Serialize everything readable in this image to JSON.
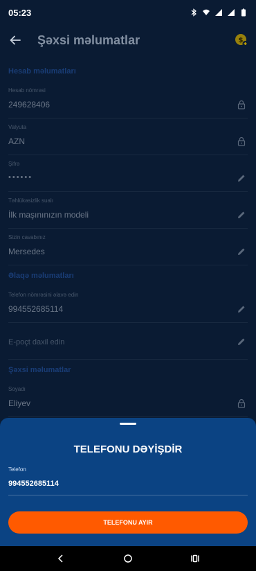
{
  "status_bar": {
    "time": "05:23"
  },
  "app_bar": {
    "title": "Şəxsi məlumatlar"
  },
  "sections": {
    "account": {
      "title": "Hesab məlumatları",
      "fields": [
        {
          "label": "Hesab nömrəsi",
          "value": "249628406",
          "icon": "lock-icon"
        },
        {
          "label": "Valyuta",
          "value": "AZN",
          "icon": "lock-icon"
        },
        {
          "label": "Şifrə",
          "value": "••••••",
          "icon": "pencil-icon"
        },
        {
          "label": "Təhlükəsizlik sualı",
          "value": "İlk maşınınızın modeli",
          "icon": "pencil-icon"
        },
        {
          "label": "Sizin cavabınız",
          "value": "Mersedes",
          "icon": "pencil-icon"
        }
      ]
    },
    "contact": {
      "title": "Əlaqə məlumatları",
      "phone_label": "Telefon nömrəsini əlavə edin",
      "phone_value": "994552685114",
      "email_placeholder": "E-poçt daxil edin"
    },
    "personal": {
      "title": "Şəxsi məlumatlar",
      "surname_label": "Soyadı",
      "surname_value": "Eliyev"
    }
  },
  "sheet": {
    "title": "TELEFONU DƏYİŞDİR",
    "phone_label": "Telefon",
    "phone_value": "994552685114",
    "button_label": "TELEFONU AYIR"
  },
  "colors": {
    "background": "#0a1b33",
    "sheet": "#0b4383",
    "accent_button": "#ff5a00",
    "section_title": "#2f6bd1"
  }
}
